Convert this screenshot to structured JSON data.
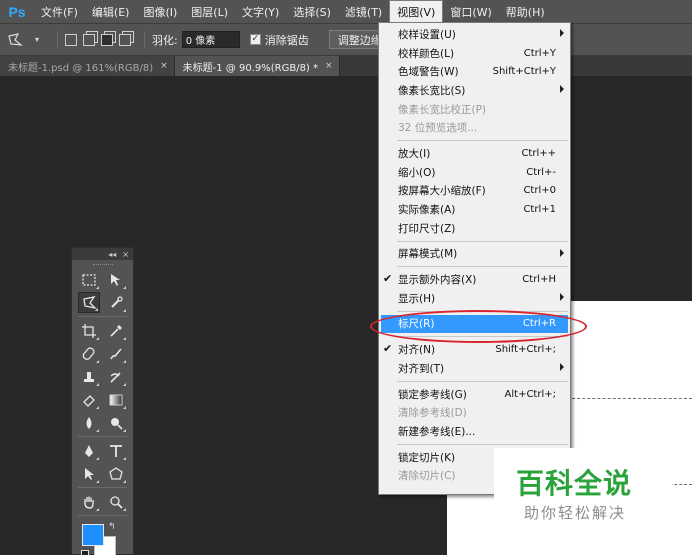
{
  "app": {
    "logo": "Ps"
  },
  "menubar": {
    "items": [
      "文件(F)",
      "编辑(E)",
      "图像(I)",
      "图层(L)",
      "文字(Y)",
      "选择(S)",
      "滤镜(T)",
      "视图(V)",
      "窗口(W)",
      "帮助(H)"
    ],
    "active": "视图(V)"
  },
  "options": {
    "feather_label": "羽化:",
    "feather_value": "0 像素",
    "antialias_label": "消除锯齿",
    "refine_button": "调整边缘..."
  },
  "tabs": [
    {
      "label": "未标题-1.psd @ 161%(RGB/8)",
      "close": "×",
      "active": false
    },
    {
      "label": "未标题-1 @ 90.9%(RGB/8) *",
      "close": "×",
      "active": true
    }
  ],
  "tools_panel": {
    "collapse": "◂◂",
    "close": "×",
    "foreground_color": "#1e8fff",
    "background_color": "#ffffff",
    "tools": [
      [
        "rect-marquee-icon",
        "move-icon"
      ],
      [
        "polygon-lasso-icon",
        "quick-select-icon"
      ],
      [
        "crop-icon",
        "eyedropper-icon"
      ],
      [
        "healing-brush-icon",
        "brush-icon"
      ],
      [
        "clone-stamp-icon",
        "history-brush-icon"
      ],
      [
        "eraser-icon",
        "gradient-icon"
      ],
      [
        "blur-icon",
        "dodge-icon"
      ],
      [
        "pen-icon",
        "type-icon"
      ],
      [
        "path-select-icon",
        "shape-icon"
      ],
      [
        "hand-icon",
        "zoom-icon"
      ]
    ],
    "selected_tool": "polygon-lasso-icon"
  },
  "view_menu": {
    "groups": [
      [
        {
          "label": "校样设置(U)",
          "shortcut": "",
          "submenu": true
        },
        {
          "label": "校样颜色(L)",
          "shortcut": "Ctrl+Y"
        },
        {
          "label": "色域警告(W)",
          "shortcut": "Shift+Ctrl+Y"
        },
        {
          "label": "像素长宽比(S)",
          "shortcut": "",
          "submenu": true
        },
        {
          "label": "像素长宽比校正(P)",
          "shortcut": "",
          "disabled": true
        },
        {
          "label": "32 位预览选项...",
          "shortcut": "",
          "disabled": true
        }
      ],
      [
        {
          "label": "放大(I)",
          "shortcut": "Ctrl++"
        },
        {
          "label": "缩小(O)",
          "shortcut": "Ctrl+-"
        },
        {
          "label": "按屏幕大小缩放(F)",
          "shortcut": "Ctrl+0"
        },
        {
          "label": "实际像素(A)",
          "shortcut": "Ctrl+1"
        },
        {
          "label": "打印尺寸(Z)",
          "shortcut": ""
        }
      ],
      [
        {
          "label": "屏幕模式(M)",
          "shortcut": "",
          "submenu": true
        }
      ],
      [
        {
          "label": "显示额外内容(X)",
          "shortcut": "Ctrl+H",
          "checked": true
        },
        {
          "label": "显示(H)",
          "shortcut": "",
          "submenu": true
        }
      ],
      [
        {
          "label": "标尺(R)",
          "shortcut": "Ctrl+R",
          "highlight": true
        }
      ],
      [
        {
          "label": "对齐(N)",
          "shortcut": "Shift+Ctrl+;",
          "checked": true
        },
        {
          "label": "对齐到(T)",
          "shortcut": "",
          "submenu": true
        }
      ],
      [
        {
          "label": "锁定参考线(G)",
          "shortcut": "Alt+Ctrl+;"
        },
        {
          "label": "清除参考线(D)",
          "shortcut": "",
          "disabled": true
        },
        {
          "label": "新建参考线(E)...",
          "shortcut": ""
        }
      ],
      [
        {
          "label": "锁定切片(K)",
          "shortcut": ""
        },
        {
          "label": "清除切片(C)",
          "shortcut": "",
          "disabled": true
        }
      ]
    ]
  },
  "watermark": {
    "title": "百科全说",
    "subtitle": "助你轻松解决"
  }
}
